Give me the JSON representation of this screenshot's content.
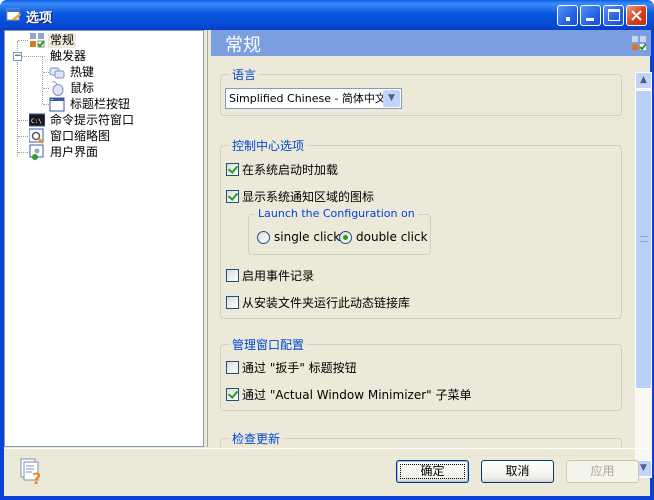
{
  "window": {
    "title": "选项",
    "icon": "options-app-icon",
    "controls": [
      "help-button",
      "minimize-button",
      "maximize-button",
      "close-button"
    ]
  },
  "tree": {
    "items": [
      {
        "label": "常规",
        "icon": "general-settings-icon",
        "level": 0,
        "selected": true
      },
      {
        "label": "触发器",
        "icon": "",
        "level": 0,
        "expanded": true
      },
      {
        "label": "热键",
        "icon": "hotkey-icon",
        "level": 1
      },
      {
        "label": "鼠标",
        "icon": "mouse-icon",
        "level": 1
      },
      {
        "label": "标题栏按钮",
        "icon": "titlebar-button-icon",
        "level": 1
      },
      {
        "label": "命令提示符窗口",
        "icon": "command-prompt-icon",
        "level": 0
      },
      {
        "label": "窗口缩略图",
        "icon": "window-thumbnail-icon",
        "level": 0
      },
      {
        "label": "用户界面",
        "icon": "user-interface-icon",
        "level": 0
      }
    ]
  },
  "panel": {
    "title": "常规",
    "icon": "general-settings-icon"
  },
  "language": {
    "group_label": "语言",
    "selected": "Simplified Chinese - 简体中文"
  },
  "control_center": {
    "group_label": "控制中心选项",
    "load_on_startup": {
      "label": "在系统启动时加载",
      "checked": true
    },
    "show_tray_icon": {
      "label": "显示系统通知区域的图标",
      "checked": true
    },
    "launch_group_label": "Launch the Configuration on",
    "single_click": {
      "label": "single click",
      "selected": false
    },
    "double_click": {
      "label": "double click",
      "selected": true
    },
    "enable_event_log": {
      "label": "启用事件记录",
      "checked": false
    },
    "run_dll_from_install": {
      "label": "从安装文件夹运行此动态链接库",
      "checked": false
    }
  },
  "manage_config": {
    "group_label": "管理窗口配置",
    "via_wrench_button": {
      "label": "通过 \"扳手\" 标题按钮",
      "checked": false
    },
    "via_submenu": {
      "label": "通过 \"Actual Window Minimizer\" 子菜单",
      "checked": true
    }
  },
  "check_updates": {
    "group_label": "检查更新"
  },
  "footer": {
    "ok_label": "确定",
    "cancel_label": "取消",
    "apply_label": "应用",
    "apply_enabled": false
  }
}
